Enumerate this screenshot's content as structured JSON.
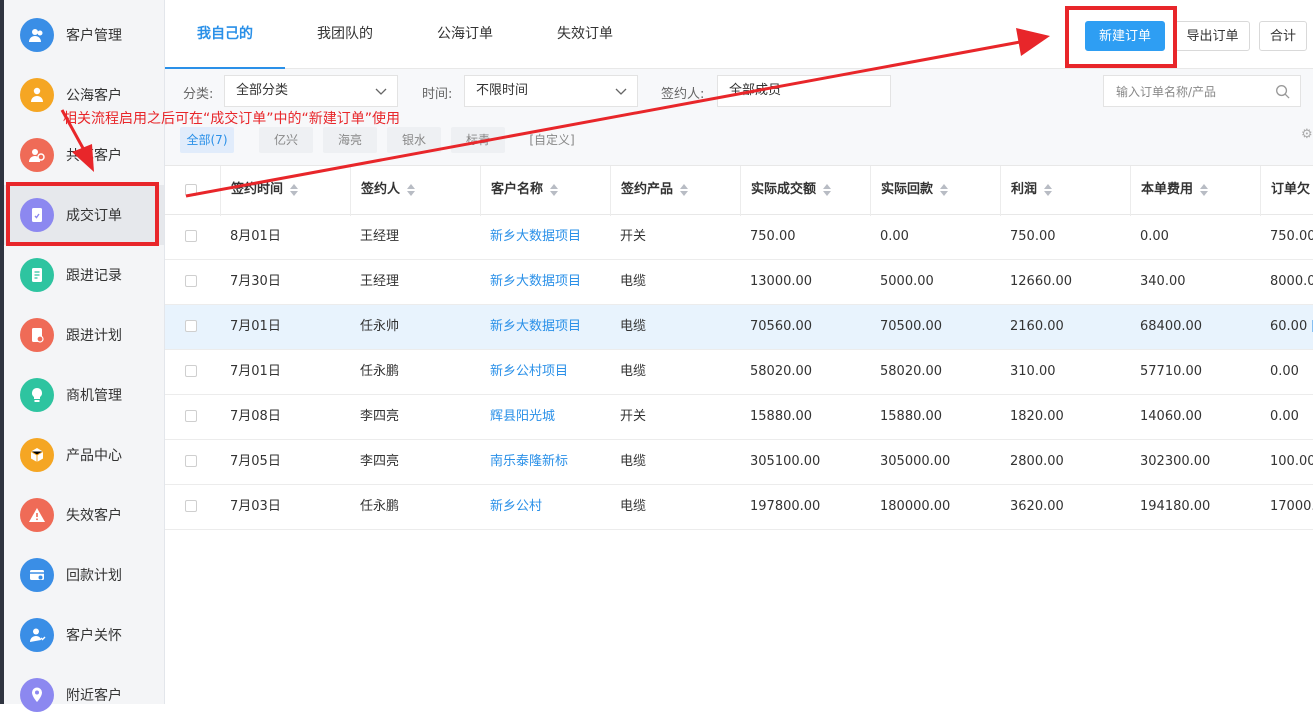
{
  "sidebar": {
    "items": [
      {
        "label": "客户管理",
        "icon": "customers-icon",
        "color": "#3a8ee6"
      },
      {
        "label": "公海客户",
        "icon": "public-customer-icon",
        "color": "#f5a623"
      },
      {
        "label": "共享客户",
        "icon": "shared-customer-icon",
        "color": "#ef6b57"
      },
      {
        "label": "成交订单",
        "icon": "order-icon",
        "color": "#8c88f0"
      },
      {
        "label": "跟进记录",
        "icon": "record-icon",
        "color": "#2ec4a0"
      },
      {
        "label": "跟进计划",
        "icon": "plan-icon",
        "color": "#ef6b57"
      },
      {
        "label": "商机管理",
        "icon": "opportunity-icon",
        "color": "#2ec4a0"
      },
      {
        "label": "产品中心",
        "icon": "product-icon",
        "color": "#f5a623"
      },
      {
        "label": "失效客户",
        "icon": "warning-icon",
        "color": "#ef6b57"
      },
      {
        "label": "回款计划",
        "icon": "payment-icon",
        "color": "#3a8ee6"
      },
      {
        "label": "客户关怀",
        "icon": "care-icon",
        "color": "#3a8ee6"
      },
      {
        "label": "附近客户",
        "icon": "location-icon",
        "color": "#8c88f0"
      }
    ]
  },
  "tabs": [
    "我自己的",
    "我团队的",
    "公海订单",
    "失效订单"
  ],
  "toolbar": {
    "new_order": "新建订单",
    "export": "导出订单",
    "total": "合计"
  },
  "filters": {
    "category_label": "分类:",
    "category_value": "全部分类",
    "time_label": "时间:",
    "time_value": "不限时间",
    "signer_label": "签约人:",
    "signer_value": "全部成员",
    "search_placeholder": "输入订单名称/产品"
  },
  "chips": [
    "全部(7)",
    "亿兴",
    "海亮",
    "银水",
    "标青",
    "[自定义]"
  ],
  "table": {
    "columns": [
      "签约时间",
      "签约人",
      "客户名称",
      "签约产品",
      "实际成交额",
      "实际回款",
      "利润",
      "本单费用",
      "订单欠"
    ],
    "rows": [
      [
        "8月01日",
        "王经理",
        "新乡大数据项目",
        "开关",
        "750.00",
        "0.00",
        "750.00",
        "0.00",
        "750.00"
      ],
      [
        "7月30日",
        "王经理",
        "新乡大数据项目",
        "电缆",
        "13000.00",
        "5000.00",
        "12660.00",
        "340.00",
        "8000.0"
      ],
      [
        "7月01日",
        "任永帅",
        "新乡大数据项目",
        "电缆",
        "70560.00",
        "70500.00",
        "2160.00",
        "68400.00",
        "60.00"
      ],
      [
        "7月01日",
        "任永鹏",
        "新乡公村项目",
        "电缆",
        "58020.00",
        "58020.00",
        "310.00",
        "57710.00",
        "0.00"
      ],
      [
        "7月08日",
        "李四亮",
        "辉县阳光城",
        "开关",
        "15880.00",
        "15880.00",
        "1820.00",
        "14060.00",
        "0.00"
      ],
      [
        "7月05日",
        "李四亮",
        "南乐泰隆新标",
        "电缆",
        "305100.00",
        "305000.00",
        "2800.00",
        "302300.00",
        "100.00"
      ],
      [
        "7月03日",
        "任永鹏",
        "新乡公村",
        "电缆",
        "197800.00",
        "180000.00",
        "3620.00",
        "194180.00",
        "17000."
      ]
    ],
    "row3_tail": "["
  },
  "annotation": {
    "text": "相关流程启用之后可在“成交订单”中的“新建订单”使用",
    "color": "#e8262a"
  }
}
